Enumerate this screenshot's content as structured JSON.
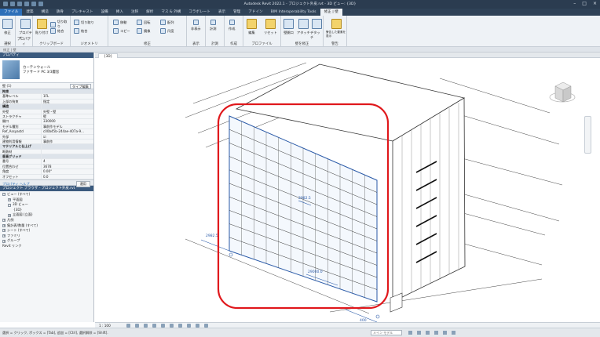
{
  "app": {
    "title": "Autodesk Revit 2022.1 - プロジェクト外皮.rvt - 3D ビュー: {3D}"
  },
  "tabs": [
    "ファイル",
    "建築",
    "構造",
    "鉄骨",
    "プレキャスト",
    "設備",
    "挿入",
    "注釈",
    "解析",
    "マス & 外構",
    "コラボレート",
    "表示",
    "管理",
    "アドイン",
    "BIM Interoperability Tools",
    "修正 | 壁"
  ],
  "ribbon": {
    "panels": [
      {
        "label": "選択",
        "buttons": [
          "修正"
        ]
      },
      {
        "label": "プロパティ",
        "buttons": [
          "プロパティ"
        ]
      },
      {
        "label": "クリップボード",
        "buttons": [
          "貼り付け",
          "切り取り",
          "結合"
        ]
      },
      {
        "label": "ジオメトリ",
        "buttons": [
          "切り取り",
          "結合"
        ]
      },
      {
        "label": "修正",
        "buttons": [
          "移動",
          "コピー",
          "回転",
          "鏡像",
          "配列",
          "尺度"
        ]
      },
      {
        "label": "表示",
        "buttons": [
          "非表示"
        ]
      },
      {
        "label": "計測",
        "buttons": [
          "計測"
        ]
      },
      {
        "label": "作成",
        "buttons": [
          "作成"
        ]
      },
      {
        "label": "プロファイル",
        "buttons": [
          "編集",
          "リセット"
        ]
      },
      {
        "label": "壁を修正",
        "buttons": [
          "壁開口",
          "アタッチ",
          "デタッチ"
        ]
      },
      {
        "label": "警告",
        "buttons": [
          "警告した要素を表示"
        ]
      }
    ]
  },
  "options_bar": {
    "label": "修正 | 壁"
  },
  "properties": {
    "header": "プロパティ",
    "type_line1": "カーテンウォール",
    "type_line2": "ファサード PC 3/3層窓",
    "selector": "壁 (1)",
    "edit_type": "タイプ編集",
    "rows": [
      {
        "k": "拘束",
        "v": "",
        "group": true
      },
      {
        "k": "基準レベル",
        "v": "1FL",
        "group": false
      },
      {
        "k": "上部の拘束",
        "v": "指定",
        "group": false
      },
      {
        "k": "構造",
        "v": "",
        "group": true
      },
      {
        "k": "外壁",
        "v": "外壁・壁",
        "group": false
      },
      {
        "k": "ストラクチャ",
        "v": "壁",
        "group": false
      },
      {
        "k": "開口",
        "v": "330000",
        "group": false
      },
      {
        "k": "モデル種別",
        "v": "事前作モデル",
        "group": false
      },
      {
        "k": "Ref_Assyastd",
        "v": "c00b45b-244ae-407a-9...",
        "group": false
      },
      {
        "k": "外部",
        "v": "☑",
        "group": false
      },
      {
        "k": "建物利用情報",
        "v": "事前作",
        "group": false
      },
      {
        "k": "マテリアルと仕上げ",
        "v": "",
        "group": true
      },
      {
        "k": "断熱材",
        "v": "",
        "group": false
      },
      {
        "k": "垂直グリッド",
        "v": "",
        "group": true
      },
      {
        "k": "番号",
        "v": "4",
        "group": false
      },
      {
        "k": "位置合わせ",
        "v": "3678",
        "group": false
      },
      {
        "k": "角度",
        "v": "0.00°",
        "group": false
      },
      {
        "k": "オフセット",
        "v": "0.0",
        "group": false
      }
    ],
    "help_link": "プロパティ ヘルプ",
    "apply": "適用"
  },
  "browser": {
    "header": "プロジェクト ブラウザ - プロジェクト外皮.rvt",
    "nodes": [
      {
        "t": "ビュー (すべて)",
        "d": 0,
        "exp": "−"
      },
      {
        "t": "平面図",
        "d": 1,
        "exp": "+"
      },
      {
        "t": "3D ビュー",
        "d": 1,
        "exp": "−"
      },
      {
        "t": "{3D}",
        "d": 2,
        "exp": ""
      },
      {
        "t": "立面図 (立面)",
        "d": 1,
        "exp": "+"
      },
      {
        "t": "凡例",
        "d": 0,
        "exp": "+"
      },
      {
        "t": "集計表/数量 (すべて)",
        "d": 0,
        "exp": "+"
      },
      {
        "t": "シート (すべて)",
        "d": 0,
        "exp": "+"
      },
      {
        "t": "ファミリ",
        "d": 0,
        "exp": "+"
      },
      {
        "t": "グループ",
        "d": 0,
        "exp": "+"
      },
      {
        "t": "Revit リンク",
        "d": 0,
        "exp": ""
      }
    ]
  },
  "view": {
    "tab": "{3D}",
    "scale": "1 : 100",
    "dim1": "2982.5",
    "dim2": "29000.0",
    "dim3": "2982.5",
    "dim4": "400",
    "dim5": "0"
  },
  "status": {
    "text": "選択 = クリック, ボックス = [Tab], 追加 = [Ctrl], 選択解除 = [Shift].",
    "workset": "メイン モデル"
  }
}
